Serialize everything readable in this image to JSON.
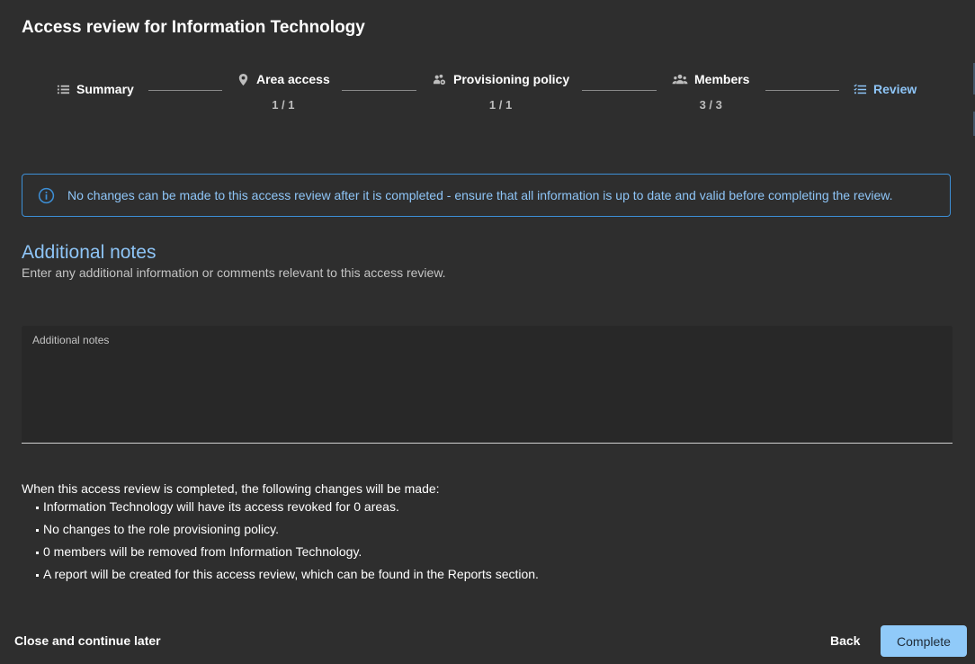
{
  "dialog": {
    "title": "Access review for Information Technology"
  },
  "stepper": {
    "steps": [
      {
        "label": "Summary",
        "icon": "list-icon",
        "count": null,
        "state": "done"
      },
      {
        "label": "Area access",
        "icon": "location-pin-icon",
        "count": "1 / 1",
        "state": "done"
      },
      {
        "label": "Provisioning policy",
        "icon": "users-gear-icon",
        "count": "1 / 1",
        "state": "done"
      },
      {
        "label": "Members",
        "icon": "users-icon",
        "count": "3 / 3",
        "state": "done"
      },
      {
        "label": "Review",
        "icon": "checklist-icon",
        "count": null,
        "state": "active"
      }
    ]
  },
  "info": {
    "icon": "info-icon",
    "text": "No changes can be made to this access review after it is completed - ensure that all information is up to date and valid before completing the review."
  },
  "notes": {
    "title": "Additional notes",
    "subtitle": "Enter any additional information or comments relevant to this access review.",
    "field_label": "Additional notes",
    "value": ""
  },
  "changes": {
    "intro": "When this access review is completed, the following changes will be made:",
    "items": [
      "Information Technology will have its access revoked for 0 areas.",
      "No changes to the role provisioning policy.",
      "0 members will be removed from Information Technology.",
      "A report will be created for this access review, which can be found in the Reports section."
    ]
  },
  "footer": {
    "close_label": "Close and continue later",
    "back_label": "Back",
    "complete_label": "Complete"
  },
  "colors": {
    "background": "#2e2e2e",
    "accent": "#8ec5f7",
    "info_border": "#3d8fd6",
    "primary_button": "#90caf9"
  }
}
